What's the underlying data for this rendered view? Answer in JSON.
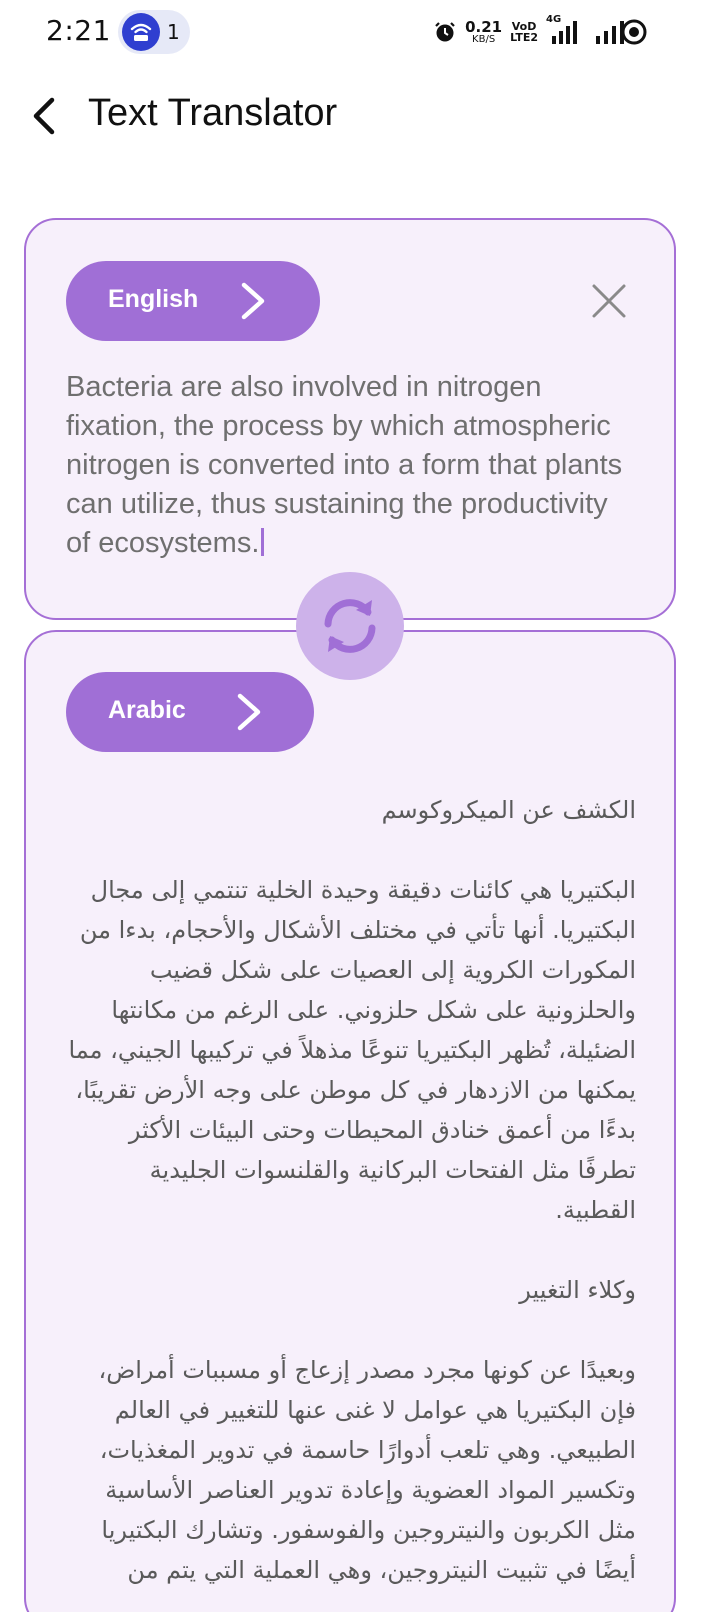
{
  "status_bar": {
    "time": "2:21",
    "hotspot_count": "1",
    "net_speed_value": "0.21",
    "net_speed_unit": "KB/S",
    "volte_top": "VoD",
    "volte_bottom": "LTE2",
    "network": "4G"
  },
  "app_bar": {
    "title": "Text Translator"
  },
  "source": {
    "language": "English",
    "text": "Bacteria are also involved in nitrogen fixation, the process by which atmospheric nitrogen is converted into a form that plants can utilize, thus sustaining the productivity of ecosystems."
  },
  "target": {
    "language": "Arabic",
    "text": "الكشف عن الميكروكوسم\n\nالبكتيريا هي كائنات دقيقة وحيدة الخلية تنتمي إلى مجال البكتيريا. أنها تأتي في مختلف الأشكال والأحجام، بدءا من المكورات الكروية إلى العصيات على شكل قضيب والحلزونية على شكل حلزوني. على الرغم من مكانتها الضئيلة، تُظهر البكتيريا تنوعًا مذهلاً في تركيبها الجيني، مما يمكنها من الازدهار في كل موطن على وجه الأرض تقريبًا، بدءًا من أعمق خنادق المحيطات وحتى البيئات الأكثر تطرفًا مثل الفتحات البركانية والقلنسوات الجليدية القطبية.\n\nوكلاء التغيير\n\nوبعيدًا عن كونها مجرد مصدر إزعاج أو مسببات أمراض، فإن البكتيريا هي عوامل لا غنى عنها للتغيير في العالم الطبيعي. وهي تلعب أدوارًا حاسمة في تدوير المغذيات، وتكسير المواد العضوية وإعادة تدوير العناصر الأساسية مثل الكربون والنيتروجين والفوسفور. وتشارك البكتيريا أيضًا في تثبيت النيتروجين، وهي العملية التي يتم من"
  },
  "colors": {
    "accent": "#a06fd6",
    "card_border": "#a56fd6",
    "card_bg": "#f7f0fb",
    "swap_bg": "#cdb2ea"
  }
}
